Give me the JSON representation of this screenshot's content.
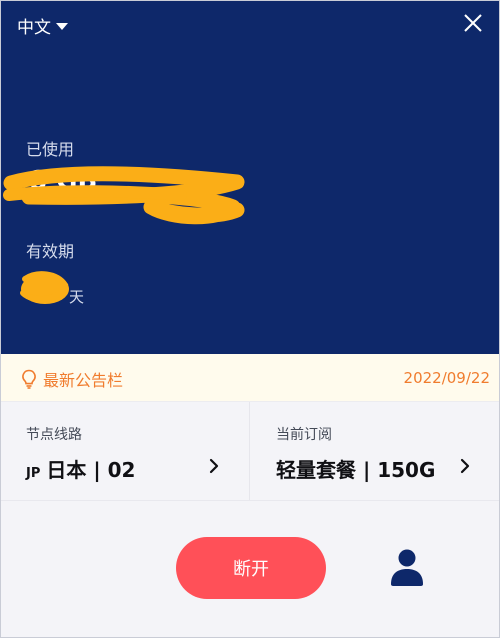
{
  "header": {
    "language": "中文",
    "language_icon": "caret-down-icon",
    "close_icon": "close-icon"
  },
  "usage": {
    "used_label": "已使用",
    "used_value": "8 GB",
    "valid_label": "有效期",
    "valid_unit": "天",
    "redaction_color": "#fbae17"
  },
  "notice": {
    "icon": "lightbulb-icon",
    "title": "最新公告栏",
    "date": "2022/09/22"
  },
  "route": {
    "label": "节点线路",
    "code": "JP",
    "value": "日本 | 02"
  },
  "subscription": {
    "label": "当前订阅",
    "value": "轻量套餐 | 150G"
  },
  "actions": {
    "disconnect_label": "断开",
    "user_icon": "user-icon"
  },
  "colors": {
    "panel": "#0e286a",
    "accent": "#ff5058",
    "notice": "#f07c2e"
  }
}
